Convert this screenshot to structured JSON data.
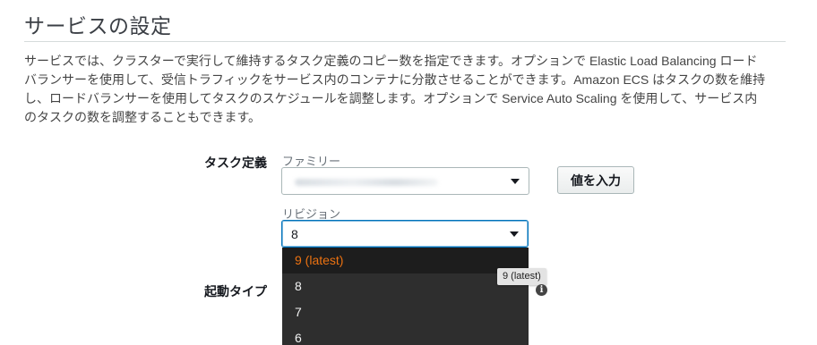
{
  "section": {
    "title": "サービスの設定",
    "description": [
      "サービスでは、クラスターで実行して維持するタスク定義のコピー数を指定できます。オプションで Elastic Load Balancing ロード",
      "バランサーを使用して、受信トラフィックをサービス内のコンテナに分散させることができます。Amazon ECS はタスクの数を維持",
      "し、ロードバランサーを使用してタスクのスケジュールを調整します。オプションで Service Auto Scaling を使用して、サービス内",
      "のタスクの数を調整することもできます。"
    ]
  },
  "task_definition": {
    "label": "タスク定義",
    "family_label": "ファミリー",
    "family_value_obscured": true,
    "enter_value_button": "値を入力",
    "revision_label": "リビジョン",
    "revision_value": "8",
    "revision_options": [
      "9 (latest)",
      "8",
      "7",
      "6"
    ],
    "highlighted_option": "9 (latest)"
  },
  "launch_type": {
    "label": "起動タイプ"
  },
  "tooltip": {
    "text": "9 (latest)"
  },
  "colors": {
    "highlight_text": "#ec7211",
    "dropdown_bg": "#2e2e2e",
    "focus_border": "#0073bb"
  },
  "icons": {
    "caret": "chevron-down-icon",
    "info": "info-icon"
  }
}
